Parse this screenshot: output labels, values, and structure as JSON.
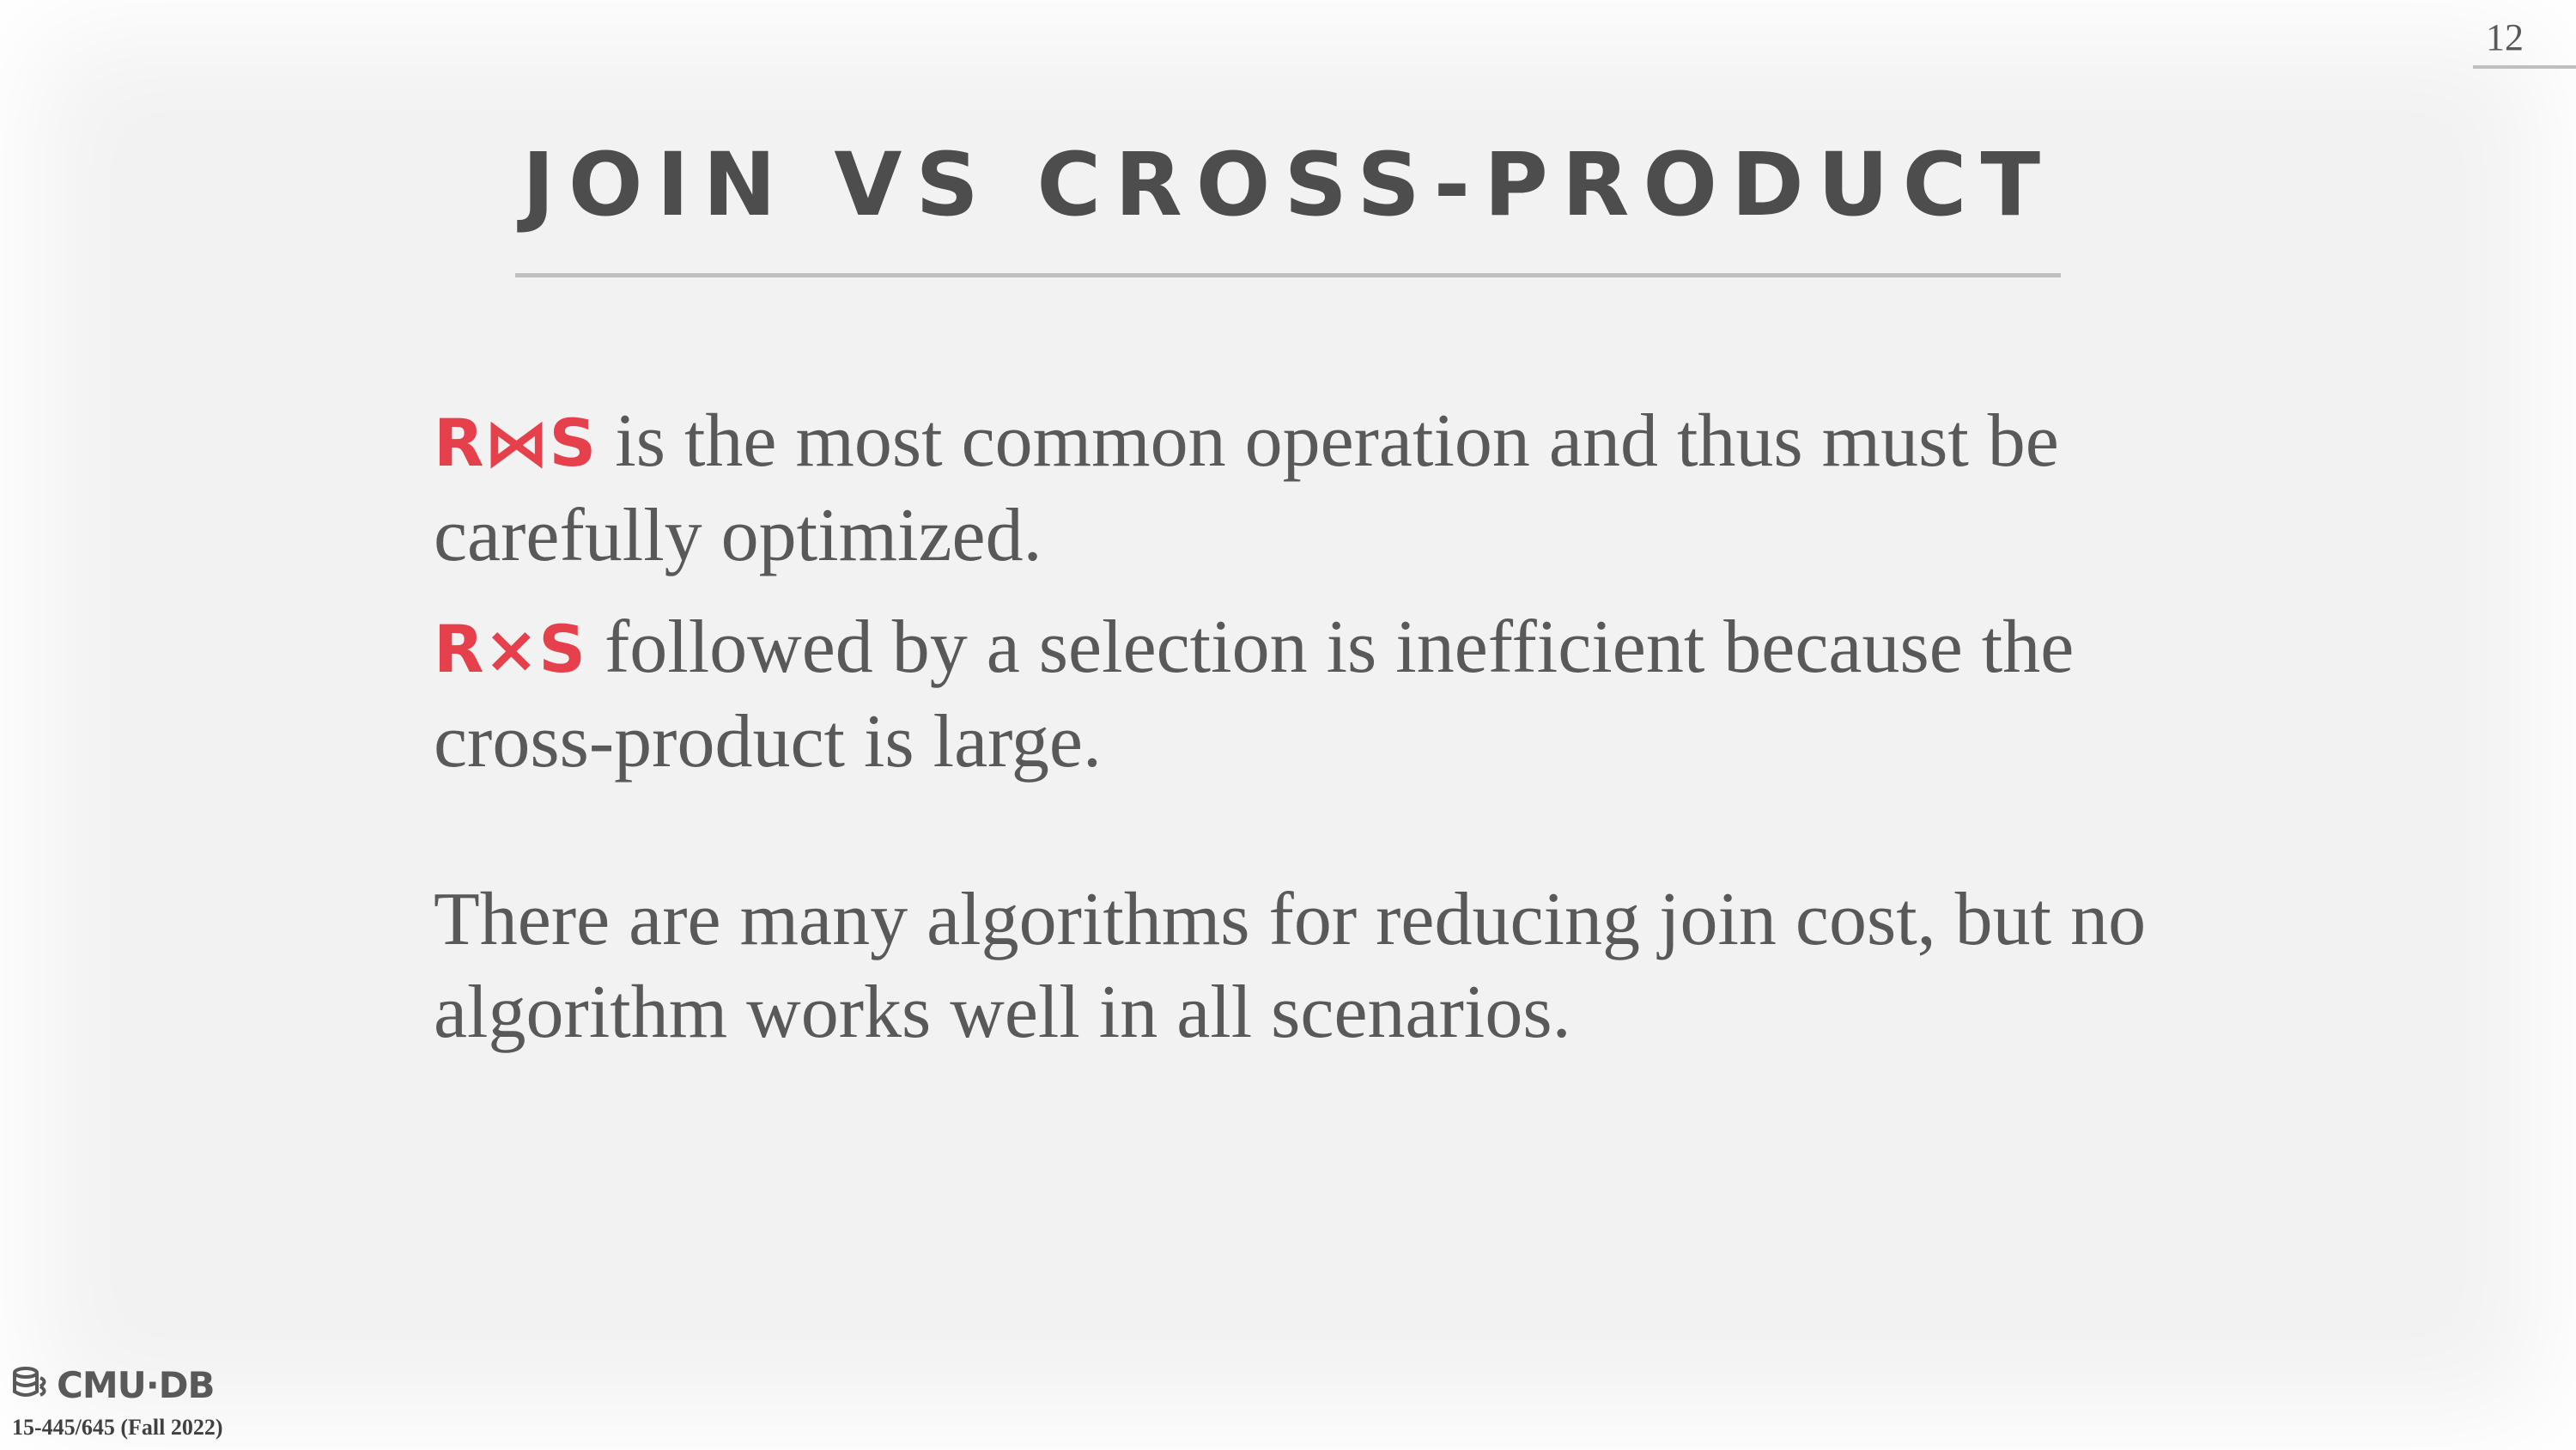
{
  "slide": {
    "page_number": "12",
    "title": "JOIN VS CROSS-PRODUCT",
    "paragraphs": [
      {
        "symbol": "R⋈S",
        "text": " is the most common operation and thus must be carefully optimized."
      },
      {
        "symbol": "R×S",
        "text": " followed by a selection is inefficient because the cross-product is large."
      },
      {
        "text": "There are many algorithms for reducing join cost, but no algorithm works well in all scenarios."
      }
    ]
  },
  "footer": {
    "logo_text": "CMU·DB",
    "logo_icon": "database-stack-icon",
    "course": "15-445/645 (Fall 2022)"
  },
  "colors": {
    "accent": "#e5404b",
    "text": "#595959",
    "title": "#4d4d4d",
    "rule": "#bfbfbf",
    "background": "#f2f2f2"
  }
}
